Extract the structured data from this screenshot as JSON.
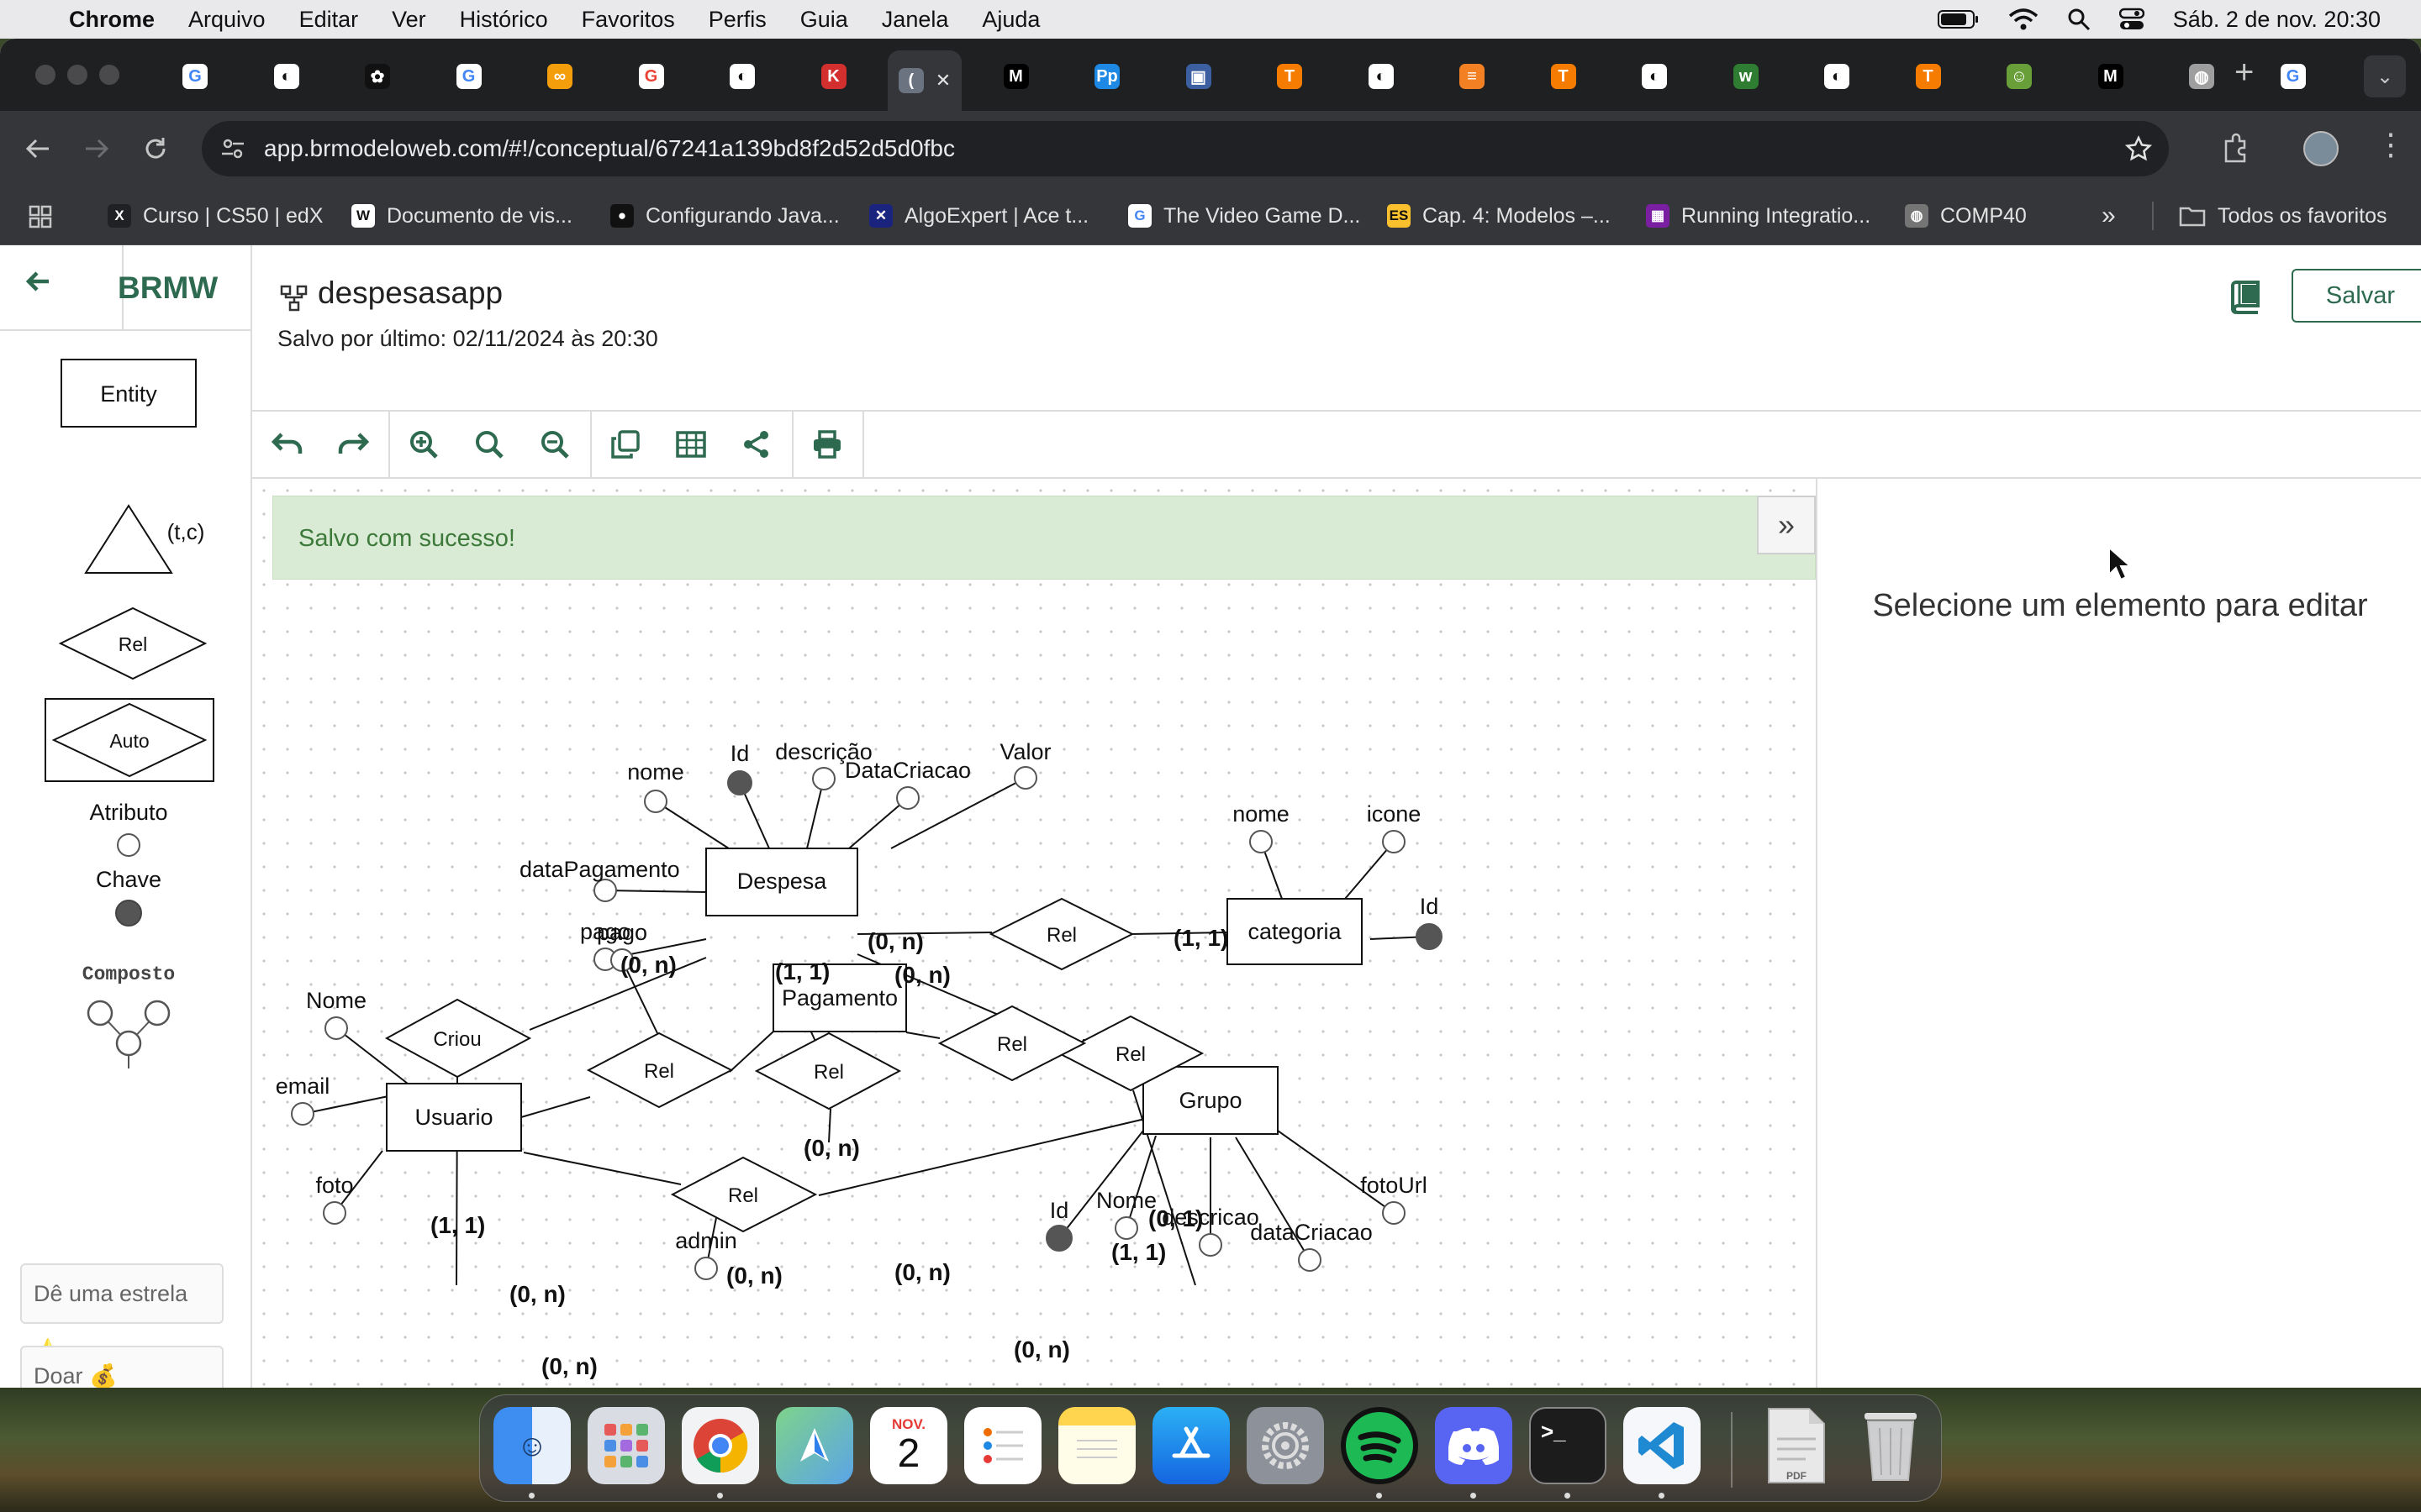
{
  "menubar": {
    "app_name": "Chrome",
    "items": [
      "Arquivo",
      "Editar",
      "Ver",
      "Histórico",
      "Favoritos",
      "Perfis",
      "Guia",
      "Janela",
      "Ajuda"
    ],
    "datetime": "Sáb. 2 de nov.  20:30"
  },
  "browser": {
    "url": "app.brmodeloweb.com/#!/conceptual/67241a139bd8f2d52d5d0fbc",
    "tabs": [
      {
        "icon": "google-icon",
        "color": "#ffffff",
        "letter": "G",
        "fg": "#4285f4"
      },
      {
        "icon": "github-icon",
        "color": "#ffffff",
        "letter": "◐",
        "fg": "#111"
      },
      {
        "icon": "openai-icon",
        "color": "#111111",
        "letter": "✿",
        "fg": "#fff"
      },
      {
        "icon": "google-icon",
        "color": "#ffffff",
        "letter": "G",
        "fg": "#4285f4"
      },
      {
        "icon": "infinity-icon",
        "color": "#f59e0b",
        "letter": "∞",
        "fg": "#fff"
      },
      {
        "icon": "google-icon",
        "color": "#ffffff",
        "letter": "G",
        "fg": "#ea4335"
      },
      {
        "icon": "github-icon",
        "color": "#ffffff",
        "letter": "◐",
        "fg": "#111"
      },
      {
        "icon": "k-icon",
        "color": "#d32f2f",
        "letter": "K",
        "fg": "#fff"
      },
      {
        "icon": "active-tab-icon",
        "color": "#6b7280",
        "letter": "(",
        "fg": "#fff"
      },
      {
        "icon": "medium-icon",
        "color": "#000000",
        "letter": "M",
        "fg": "#fff"
      },
      {
        "icon": "pp-icon",
        "color": "#1e88e5",
        "letter": "Pp",
        "fg": "#fff"
      },
      {
        "icon": "cube-icon",
        "color": "#3b5fa0",
        "letter": "▣",
        "fg": "#fff"
      },
      {
        "icon": "tensorflow-icon",
        "color": "#f57c00",
        "letter": "T",
        "fg": "#fff"
      },
      {
        "icon": "github-icon",
        "color": "#ffffff",
        "letter": "◐",
        "fg": "#111"
      },
      {
        "icon": "stackoverflow-icon",
        "color": "#f48024",
        "letter": "≡",
        "fg": "#fff"
      },
      {
        "icon": "tensorflow-icon",
        "color": "#f57c00",
        "letter": "T",
        "fg": "#fff"
      },
      {
        "icon": "github-icon",
        "color": "#ffffff",
        "letter": "◐",
        "fg": "#111"
      },
      {
        "icon": "w3-icon",
        "color": "#2e7d32",
        "letter": "w",
        "fg": "#fff"
      },
      {
        "icon": "github-icon",
        "color": "#ffffff",
        "letter": "◐",
        "fg": "#111"
      },
      {
        "icon": "tensorflow-icon",
        "color": "#f57c00",
        "letter": "T",
        "fg": "#fff"
      },
      {
        "icon": "frog-icon",
        "color": "#689f38",
        "letter": "☺",
        "fg": "#fff"
      },
      {
        "icon": "medium-icon",
        "color": "#000000",
        "letter": "M",
        "fg": "#fff"
      },
      {
        "icon": "globe-icon",
        "color": "#9e9e9e",
        "letter": "◍",
        "fg": "#fff"
      },
      {
        "icon": "google-icon",
        "color": "#ffffff",
        "letter": "G",
        "fg": "#4285f4"
      },
      {
        "icon": "google-icon",
        "color": "#ffffff",
        "letter": "G",
        "fg": "#ea4335"
      }
    ],
    "bookmarks": [
      {
        "label": "Curso | CS50 | edX",
        "icon": "X",
        "color": "#202124"
      },
      {
        "label": "Documento de vis...",
        "icon": "W",
        "color": "#ffffff",
        "fg": "#111"
      },
      {
        "label": "Configurando Java...",
        "icon": "●",
        "color": "#111111"
      },
      {
        "label": "AlgoExpert | Ace t...",
        "icon": "✕",
        "color": "#1a237e"
      },
      {
        "label": "The Video Game D...",
        "icon": "G",
        "color": "#ffffff",
        "fg": "#4285f4"
      },
      {
        "label": "Cap. 4: Modelos –...",
        "icon": "ES",
        "color": "#fbc02d",
        "fg": "#111"
      },
      {
        "label": "Running Integratio...",
        "icon": "▦",
        "color": "#7b1fa2"
      },
      {
        "label": "COMP40",
        "icon": "◍",
        "color": "#757575"
      }
    ],
    "all_bookmarks": "Todos os favoritos"
  },
  "app": {
    "brand": "BRMW",
    "doc_title": "despesasapp",
    "last_saved": "Salvo por último: 02/11/2024 às 20:30",
    "save_label": "Salvar",
    "alert": "Salvo com sucesso!",
    "right_panel_msg": "Selecione um elemento para editar",
    "palette": {
      "entity": "Entity",
      "specialization": "(t,c)",
      "relationship": "Rel",
      "associative": "Auto",
      "attribute": "Atributo",
      "key": "Chave",
      "composite": "Composto"
    },
    "star_label": "Dê uma estrela ⭐",
    "donate_label": "Doar 💰"
  },
  "diagram": {
    "entities": [
      "Despesa",
      "categoria",
      "Pagamento",
      "Usuario",
      "Grupo"
    ],
    "relationships": [
      "Rel",
      "Rel",
      "Rel",
      "Criou",
      "Rel",
      "Rel",
      "Rel"
    ],
    "attributes": {
      "Despesa": [
        "nome",
        "Id",
        "descrição",
        "DataCriacao",
        "Valor",
        "dataPagamento",
        "pago"
      ],
      "categoria": [
        "nome",
        "icone",
        "Id"
      ],
      "Usuario": [
        "Nome",
        "email",
        "foto"
      ],
      "Grupo": [
        "Id",
        "Nome",
        "descricao",
        "dataCriacao",
        "fotoUrl"
      ],
      "Rel_Usuario_Pagamento": [
        "pago"
      ],
      "Rel_Usuario_Grupo": [
        "admin"
      ]
    },
    "cardinalities": [
      "(0, n)",
      "(1, 1)",
      "(0, n)",
      "(1, 1)",
      "(0, n)",
      "(0, n)",
      "(0, 1)",
      "(1, 1)",
      "(0, n)",
      "(0, n)",
      "(0, n)",
      "(1, 1)",
      "(0, n)",
      "(0, n)"
    ]
  },
  "dock": {
    "apps": [
      "finder",
      "launchpad",
      "chrome",
      "maps",
      "calendar",
      "reminders",
      "notes",
      "app-store",
      "system-settings",
      "spotify",
      "discord",
      "terminal",
      "vscode",
      "pdf",
      "trash"
    ],
    "calendar_month": "NOV.",
    "calendar_day": "2"
  }
}
